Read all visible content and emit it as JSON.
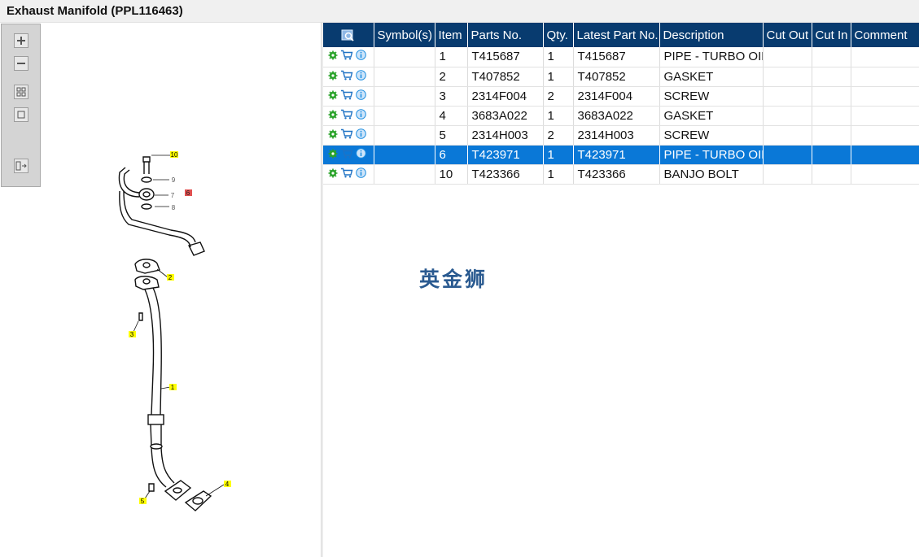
{
  "window": {
    "title": "Exhaust Manifold (PPL116463)"
  },
  "toolbar": {
    "tools": [
      {
        "name": "zoom-in",
        "icon": "zoom-in-icon"
      },
      {
        "name": "zoom-out",
        "icon": "zoom-out-icon"
      },
      {
        "name": "fit-all",
        "icon": "fit-all-icon"
      },
      {
        "name": "fit-selection",
        "icon": "fit-selection-icon"
      },
      {
        "name": "split-view",
        "icon": "split-view-icon"
      }
    ]
  },
  "diagram": {
    "callouts": [
      "10",
      "9",
      "7",
      "6",
      "8",
      "2",
      "3",
      "1",
      "4",
      "5"
    ]
  },
  "table": {
    "columns": [
      "",
      "Symbol(s)",
      "Item",
      "Parts No.",
      "Qty.",
      "Latest Part No.",
      "Description",
      "Cut Out",
      "Cut In",
      "Comment"
    ],
    "rows": [
      {
        "item": "1",
        "part_no": "T415687",
        "qty": "1",
        "latest": "T415687",
        "desc": "PIPE - TURBO OIL RETURN"
      },
      {
        "item": "2",
        "part_no": "T407852",
        "qty": "1",
        "latest": "T407852",
        "desc": "GASKET"
      },
      {
        "item": "3",
        "part_no": "2314F004",
        "qty": "2",
        "latest": "2314F004",
        "desc": "SCREW"
      },
      {
        "item": "4",
        "part_no": "3683A022",
        "qty": "1",
        "latest": "3683A022",
        "desc": "GASKET"
      },
      {
        "item": "5",
        "part_no": "2314H003",
        "qty": "2",
        "latest": "2314H003",
        "desc": "SCREW"
      },
      {
        "item": "6",
        "part_no": "T423971",
        "qty": "1",
        "latest": "T423971",
        "desc": "PIPE - TURBO OIL FEED"
      },
      {
        "item": "10",
        "part_no": "T423366",
        "qty": "1",
        "latest": "T423366",
        "desc": "BANJO BOLT"
      }
    ],
    "selected_row_index": 5
  },
  "watermark": "英金狮",
  "colors": {
    "header_bg": "#083b6f",
    "selected_row": "#0a78d7",
    "callout_highlight": "#ffff00",
    "callout_selected": "#e05050",
    "gear_icon": "#2aa32a",
    "cart_icon": "#1f72c4",
    "info_icon": "#1f8fe0"
  }
}
